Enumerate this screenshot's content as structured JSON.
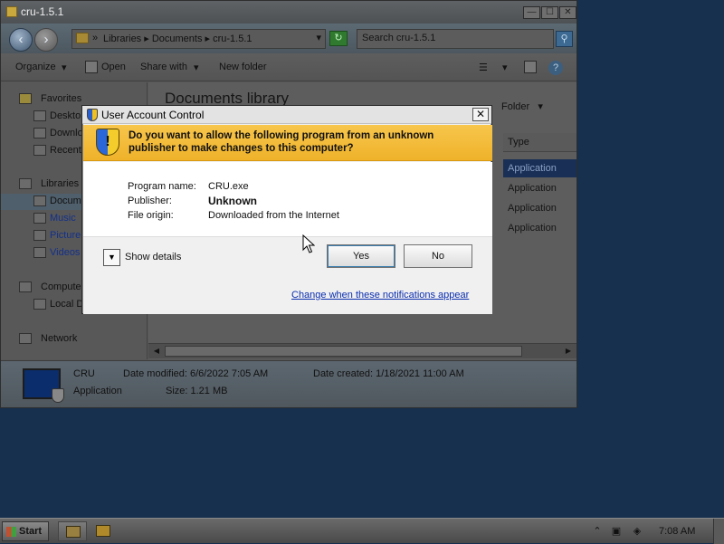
{
  "explorer": {
    "title": "cru-1.5.1",
    "window_buttons": {
      "minimize": "—",
      "maximize": "☐",
      "close": "✕"
    },
    "address": {
      "part1": "Libraries",
      "part2": "Documents",
      "part3": "cru-1.5.1"
    },
    "search_placeholder": "Search cru-1.5.1",
    "toolbar": {
      "organize": "Organize",
      "open": "Open",
      "share_with": "Share with",
      "new_folder": "New folder"
    },
    "nav": {
      "favorites": "Favorites",
      "desktop": "Deskto",
      "downloads": "Downlo",
      "recent": "Recent",
      "libraries": "Libraries",
      "documents": "Docum",
      "music": "Music",
      "pictures": "Picture",
      "videos": "Videos",
      "computer": "Computer",
      "local_disk": "Local D",
      "network": "Network"
    },
    "content": {
      "library_title": "Documents library",
      "arrange_value": "Folder",
      "column_type": "Type",
      "rows": [
        "Application",
        "Application",
        "Application",
        "Application"
      ]
    },
    "details": {
      "name": "CRU",
      "kind": "Application",
      "date_modified": "Date modified: 6/6/2022 7:05 AM",
      "size": "Size: 1.21 MB",
      "date_created": "Date created: 1/18/2021 11:00 AM"
    }
  },
  "uac": {
    "title": "User Account Control",
    "close": "✕",
    "banner_line1": "Do you want to allow the following program from an unknown",
    "banner_line2": "publisher to make changes to this computer?",
    "program_label": "Program name:",
    "program_value": "CRU.exe",
    "publisher_label": "Publisher:",
    "publisher_value": "Unknown",
    "origin_label": "File origin:",
    "origin_value": "Downloaded from the Internet",
    "show_details": "Show details",
    "yes": "Yes",
    "no": "No",
    "change_link": "Change when these notifications appear"
  },
  "taskbar": {
    "start": "Start",
    "clock": "7:08 AM"
  },
  "icons": {
    "shield": "uac-shield-icon",
    "folder": "folder-icon",
    "search": "search-icon"
  },
  "colors": {
    "banner": "#efb22a",
    "link": "#0b2eb0",
    "selection": "#192f55"
  }
}
